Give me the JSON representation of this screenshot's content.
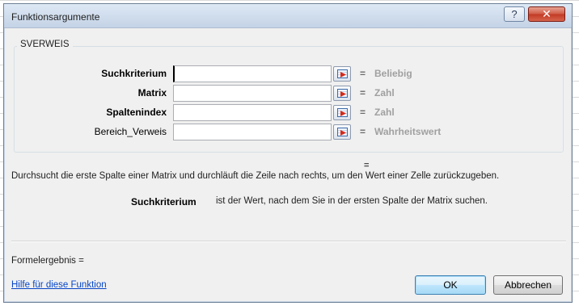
{
  "window": {
    "title": "Funktionsargumente",
    "help_glyph": "?",
    "close_glyph": "✕"
  },
  "function_name": "SVERWEIS",
  "arguments": [
    {
      "label": "Suchkriterium",
      "bold": true,
      "value": "",
      "result": "Beliebig"
    },
    {
      "label": "Matrix",
      "bold": true,
      "value": "",
      "result": "Zahl"
    },
    {
      "label": "Spaltenindex",
      "bold": true,
      "value": "",
      "result": "Zahl"
    },
    {
      "label": "Bereich_Verweis",
      "bold": false,
      "value": "",
      "result": "Wahrheitswert"
    }
  ],
  "equals_sign": "=",
  "function_result_equals": "=",
  "description": "Durchsucht die erste Spalte einer Matrix und durchläuft die Zeile nach rechts, um den Wert einer Zelle zurückzugeben.",
  "argument_help": {
    "name": "Suchkriterium",
    "text": "ist der Wert, nach dem Sie in der ersten Spalte der Matrix suchen."
  },
  "formula_result_label": "Formelergebnis =",
  "help_link": "Hilfe für diese Funktion",
  "buttons": {
    "ok": "OK",
    "cancel": "Abbrechen"
  },
  "colors": {
    "dialog_bg": "#f0f0f0",
    "titlebar": "#cfdcec",
    "result_gray": "#a0a0a0",
    "link": "#0645c8",
    "close_red": "#c23a24"
  }
}
